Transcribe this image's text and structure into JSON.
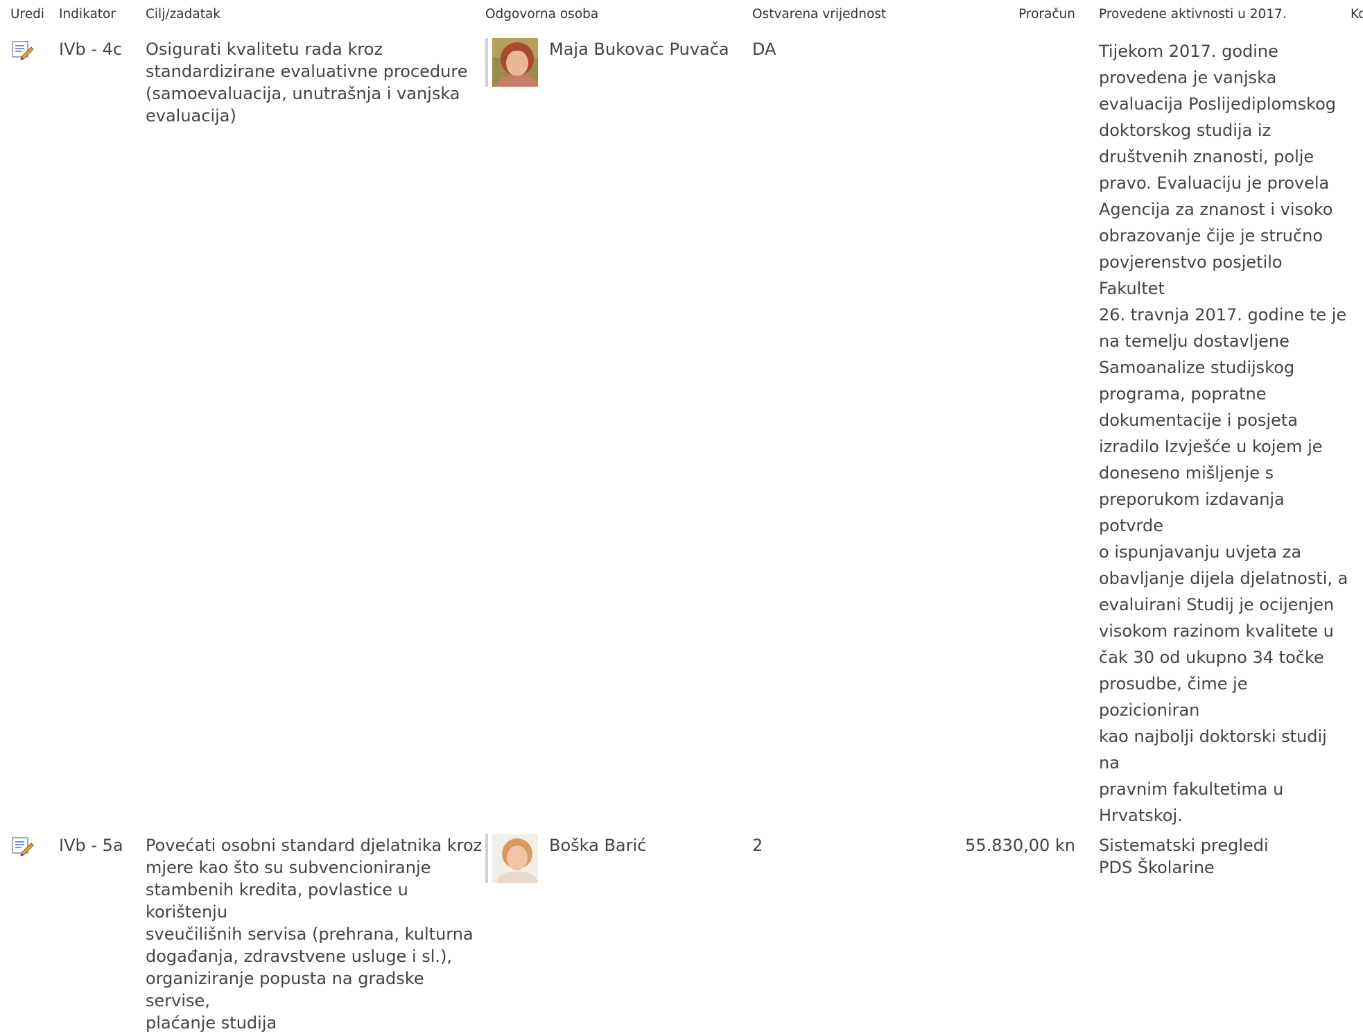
{
  "columns": {
    "uredi": "Uredi",
    "indikator": "Indikator",
    "cilj": "Cilj/zadatak",
    "osoba": "Odgovorna osoba",
    "vrijednost": "Ostvarena vrijednost",
    "proracun": "Proračun",
    "aktivnosti": "Provedene aktivnosti u 2017.",
    "komentar": "Komentar"
  },
  "rows": [
    {
      "edit_icon": "edit-document-icon",
      "indikator": "IVb - 4c",
      "cilj_lines": [
        "Osigurati kvalitetu rada kroz",
        "standardizirane evaluativne procedure",
        "(samoevaluacija, unutrašnja i vanjska",
        "evaluacija)"
      ],
      "osoba": "Maja Bukovac Puvača",
      "vrijednost": "DA",
      "proracun": "",
      "aktivnosti_lines": [
        "Tijekom 2017. godine",
        "provedena je vanjska",
        "evaluacija Poslijediplomskog",
        "doktorskog studija iz",
        "društvenih znanosti, polje",
        "pravo. Evaluaciju je provela",
        "Agencija za znanost i visoko",
        "obrazovanje čije je stručno",
        "povjerenstvo posjetilo Fakultet",
        "26. travnja 2017. godine te je",
        "na temelju dostavljene",
        "Samoanalize studijskog",
        "programa, popratne",
        "dokumentacije i posjeta",
        "izradilo Izvješće u kojem je",
        "doneseno mišljenje s",
        "preporukom izdavanja potvrde",
        "o ispunjavanju uvjeta za",
        "obavljanje dijela djelatnosti, a",
        "evaluirani Studij je ocijenjen",
        "visokom razinom kvalitete u",
        "čak 30 od ukupno 34 točke",
        "prosudbe, čime je pozicioniran",
        "kao najbolji doktorski studij na",
        "pravnim fakultetima u",
        "Hrvatskoj."
      ],
      "komentar": ""
    },
    {
      "edit_icon": "edit-document-icon",
      "indikator": "IVb - 5a",
      "cilj_lines": [
        "Povećati osobni standard djelatnika kroz",
        "mjere kao što su subvencioniranje",
        "stambenih kredita, povlastice u korištenju",
        "sveučilišnih servisa (prehrana, kulturna",
        "događanja, zdravstvene usluge i sl.),",
        "organiziranje popusta na gradske servise,",
        "plaćanje studija"
      ],
      "osoba": "Boška Barić",
      "vrijednost": "2",
      "proracun": "55.830,00 kn",
      "aktivnosti_lines": [
        "Sistematski pregledi",
        "PDS Školarine"
      ],
      "komentar": ""
    }
  ]
}
